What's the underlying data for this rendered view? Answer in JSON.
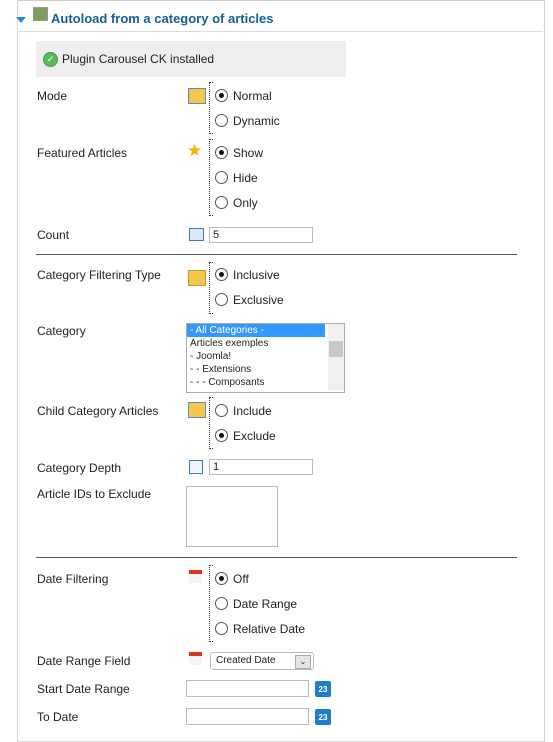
{
  "header": {
    "title": "Autoload from a category of articles"
  },
  "message": "Plugin Carousel CK installed",
  "mode": {
    "label": "Mode",
    "options": [
      "Normal",
      "Dynamic"
    ],
    "selected": "Normal"
  },
  "featured": {
    "label": "Featured Articles",
    "options": [
      "Show",
      "Hide",
      "Only"
    ],
    "selected": "Show"
  },
  "count": {
    "label": "Count",
    "value": "5"
  },
  "cat_filter": {
    "label": "Category Filtering Type",
    "options": [
      "Inclusive",
      "Exclusive"
    ],
    "selected": "Inclusive"
  },
  "category": {
    "label": "Category",
    "items": [
      "- All Categories -",
      "Articles exemples",
      "- Joomla!",
      "- - Extensions",
      "- - - Composants"
    ],
    "selected": "- All Categories -"
  },
  "child": {
    "label": "Child Category Articles",
    "options": [
      "Include",
      "Exclude"
    ],
    "selected": "Exclude"
  },
  "depth": {
    "label": "Category Depth",
    "value": "1"
  },
  "exclude": {
    "label": "Article IDs to Exclude",
    "value": ""
  },
  "date_filter": {
    "label": "Date Filtering",
    "options": [
      "Off",
      "Date Range",
      "Relative Date"
    ],
    "selected": "Off"
  },
  "date_field": {
    "label": "Date Range Field",
    "value": "Created Date"
  },
  "start": {
    "label": "Start Date Range",
    "value": ""
  },
  "to": {
    "label": "To Date",
    "value": ""
  },
  "calendar_icon_text": "23"
}
